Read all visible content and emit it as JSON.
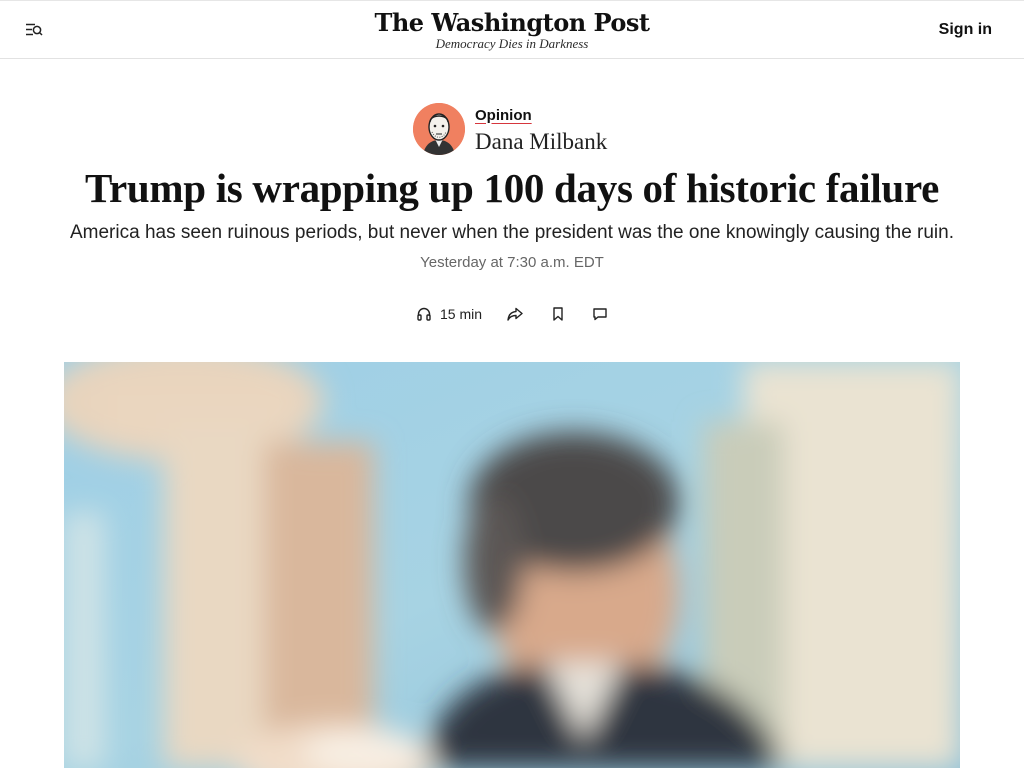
{
  "header": {
    "menu_icon": "menu-search-icon",
    "brand_name": "The Washington Post",
    "brand_tagline": "Democracy Dies in Darkness",
    "signin_label": "Sign in"
  },
  "article": {
    "section_label": "Opinion",
    "author_name": "Dana Milbank",
    "headline": "Trump is wrapping up 100 days of historic failure",
    "dek": "America has seen ruinous periods, but never when the president was the one knowingly causing the ruin.",
    "timestamp": "Yesterday at 7:30 a.m. EDT"
  },
  "actions": {
    "listen_icon": "headphones-icon",
    "listen_label": "15 min",
    "share_icon": "share-icon",
    "save_icon": "bookmark-icon",
    "comments_icon": "comment-icon"
  },
  "colors": {
    "accent_underline": "#d6363d",
    "avatar_bg": "#f08060",
    "timestamp_gray": "#666666"
  }
}
